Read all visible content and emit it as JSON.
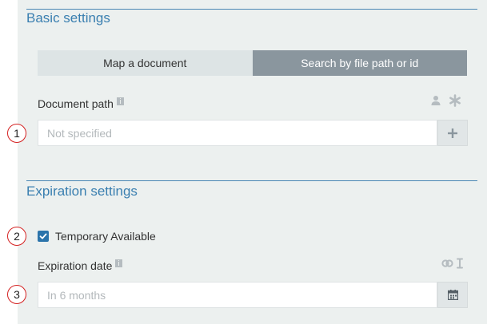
{
  "basic_settings": {
    "title": "Basic settings",
    "tabs": [
      {
        "label": "Map a document",
        "active": false
      },
      {
        "label": "Search by file path or id",
        "active": true
      }
    ],
    "document_path": {
      "label": "Document path",
      "placeholder": "Not specified",
      "value": ""
    }
  },
  "expiration_settings": {
    "title": "Expiration settings",
    "temporary_available": {
      "label": "Temporary Available",
      "checked": true
    },
    "expiration_date": {
      "label": "Expiration date",
      "placeholder": "In 6 months",
      "value": ""
    }
  },
  "markers": [
    "1",
    "2",
    "3"
  ],
  "colors": {
    "accent": "#3a7fb0",
    "active_tab": "#8a969e",
    "marker": "#d42020"
  }
}
